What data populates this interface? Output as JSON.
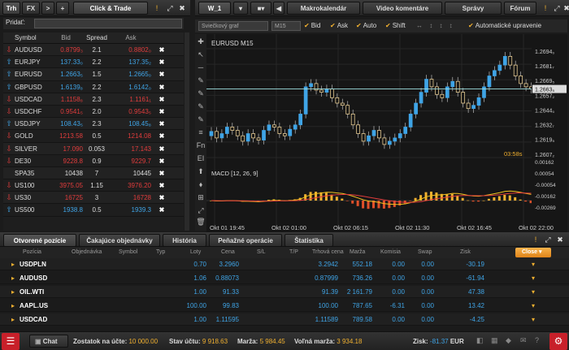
{
  "top_left_tabs": [
    "Trh",
    "FX",
    ">",
    "+"
  ],
  "panel_title": "Click & Trade",
  "add_label": "Pridať:",
  "quote_headers": [
    "Symbol",
    "Bid",
    "Spread",
    "Ask"
  ],
  "quotes": [
    {
      "dir": "down",
      "symbol": "AUDUSD",
      "bid": "0.8799₃",
      "spread": "2.1",
      "ask": "0.8802₀",
      "color": "down"
    },
    {
      "dir": "up",
      "symbol": "EURJPY",
      "bid": "137.33₀",
      "spread": "2.2",
      "ask": "137.35₂",
      "color": "up"
    },
    {
      "dir": "up",
      "symbol": "EURUSD",
      "bid": "1.2663₅",
      "spread": "1.5",
      "ask": "1.2665₀",
      "color": "up"
    },
    {
      "dir": "up",
      "symbol": "GBPUSD",
      "bid": "1.6139₈",
      "spread": "2.2",
      "ask": "1.6142₀",
      "color": "up"
    },
    {
      "dir": "down",
      "symbol": "USDCAD",
      "bid": "1.1158₈",
      "spread": "2.3",
      "ask": "1.1161₁",
      "color": "down"
    },
    {
      "dir": "down",
      "symbol": "USDCHF",
      "bid": "0.9541₅",
      "spread": "2.0",
      "ask": "0.9543₅",
      "color": "down"
    },
    {
      "dir": "up",
      "symbol": "USDJPY",
      "bid": "108.43₅",
      "spread": "2.3",
      "ask": "108.45₈",
      "color": "up"
    },
    {
      "dir": "down",
      "symbol": "GOLD",
      "bid": "1213.58",
      "spread": "0.5",
      "ask": "1214.08",
      "color": "down"
    },
    {
      "dir": "down",
      "symbol": "SILVER",
      "bid": "17.090",
      "spread": "0.053",
      "ask": "17.143",
      "color": "down"
    },
    {
      "dir": "down",
      "symbol": "DE30",
      "bid": "9228.8",
      "spread": "0.9",
      "ask": "9229.7",
      "color": "down"
    },
    {
      "dir": "none",
      "symbol": "SPA35",
      "bid": "10438",
      "spread": "7",
      "ask": "10445",
      "color": "neu"
    },
    {
      "dir": "down",
      "symbol": "US100",
      "bid": "3975.05",
      "spread": "1.15",
      "ask": "3976.20",
      "color": "down"
    },
    {
      "dir": "down",
      "symbol": "US30",
      "bid": "16725",
      "spread": "3",
      "ask": "16728",
      "color": "down"
    },
    {
      "dir": "up",
      "symbol": "US500",
      "bid": "1938.8",
      "spread": "0.5",
      "ask": "1939.3",
      "color": "up"
    }
  ],
  "chart_tabs": [
    "W_1",
    "Makrokalendár",
    "Video komentáre",
    "Správy",
    "Fórum"
  ],
  "chart_toolbar": {
    "chart_type": "Sviečkový graf",
    "timeframe": "M15",
    "bid": "Bid",
    "ask": "Ask",
    "auto": "Auto",
    "shift": "Shift",
    "auto_adjust": "Automatické upravenie"
  },
  "chart_data": {
    "type": "line",
    "title": "EURUSD M15",
    "indicator": "MACD [12, 26, 9]",
    "countdown": "03:58s",
    "current_price": "1.2663₅",
    "price_ticks": [
      "1.2694₀",
      "1.2681₇",
      "1.2669₅",
      "1.2657₂",
      "1.2644₀",
      "1.2632₇",
      "1.2619₅",
      "1.2607₂"
    ],
    "macd_ticks": [
      "0.00162",
      "0.00054",
      "-0.00054",
      "-0.00162",
      "-0.00269"
    ],
    "time_ticks": [
      "Okt 01 19:45",
      "Okt 02 01:00",
      "Okt 02 06:15",
      "Okt 02 11:30",
      "Okt 02 16:45",
      "Okt 02 22:00"
    ],
    "close": [
      1.2624,
      1.2618,
      1.2622,
      1.2628,
      1.2625,
      1.262,
      1.2615,
      1.2622,
      1.2618,
      1.2616,
      1.2625,
      1.263,
      1.2628,
      1.2622,
      1.262,
      1.2626,
      1.263,
      1.264,
      1.2665,
      1.2668,
      1.2662,
      1.266,
      1.2663,
      1.2655,
      1.265,
      1.2648,
      1.264,
      1.263,
      1.2622,
      1.2615,
      1.262,
      1.2625,
      1.2618,
      1.2612,
      1.2615,
      1.2618,
      1.2622,
      1.2628,
      1.264,
      1.265,
      1.266,
      1.2672,
      1.2665,
      1.2658,
      1.2655,
      1.2665,
      1.267,
      1.266,
      1.265,
      1.2645,
      1.2648,
      1.2655,
      1.2665,
      1.2675,
      1.268,
      1.2685,
      1.2693,
      1.2685,
      1.2675,
      1.2668,
      1.2665,
      1.2663
    ]
  },
  "bottom_tabs": [
    "Otvorené pozície",
    "Čakajúce objednávky",
    "História",
    "Peňažné operácie",
    "Štatistika"
  ],
  "position_headers": [
    "Pozícia",
    "Objednávka",
    "Symbol",
    "Typ",
    "Loty",
    "Cena",
    "S/L",
    "T/P",
    "Trhová cena",
    "Marža",
    "Komisia",
    "Swap",
    "Zisk"
  ],
  "close_label": "Close",
  "positions": [
    {
      "symbol": "USDPLN",
      "lots": "0.70",
      "price": "3.2960",
      "market": "3.2942",
      "margin": "552.18",
      "commission": "0.00",
      "swap": "0.00",
      "profit": "-30.19"
    },
    {
      "symbol": "AUDUSD",
      "lots": "1.06",
      "price": "0.88073",
      "market": "0.87999",
      "margin": "736.26",
      "commission": "0.00",
      "swap": "0.00",
      "profit": "-61.94"
    },
    {
      "symbol": "OIL.WTI",
      "lots": "1.00",
      "price": "91.33",
      "market": "91.39",
      "margin": "2 161.79",
      "commission": "0.00",
      "swap": "0.00",
      "profit": "47.38"
    },
    {
      "symbol": "AAPL.US",
      "lots": "100.00",
      "price": "99.83",
      "market": "100.00",
      "margin": "787.65",
      "commission": "-6.31",
      "swap": "0.00",
      "profit": "13.42"
    },
    {
      "symbol": "USDCAD",
      "lots": "1.00",
      "price": "1.11595",
      "market": "1.11589",
      "margin": "789.58",
      "commission": "0.00",
      "swap": "0.00",
      "profit": "-4.25"
    }
  ],
  "status": {
    "chat": "Chat",
    "balance_label": "Zostatok na účte:",
    "balance": "10 000.00",
    "equity_label": "Stav účtu:",
    "equity": "9 918.63",
    "margin_label": "Marža:",
    "margin": "5 984.45",
    "free_margin_label": "Voľná marža:",
    "free_margin": "3 934.18",
    "profit_label": "Zisk:",
    "profit": "-81.37",
    "currency": "EUR"
  },
  "colors": {
    "up": "#3fa4e6",
    "down": "#e03c3c",
    "accent": "#f0b030",
    "brand_red": "#c8202a"
  }
}
